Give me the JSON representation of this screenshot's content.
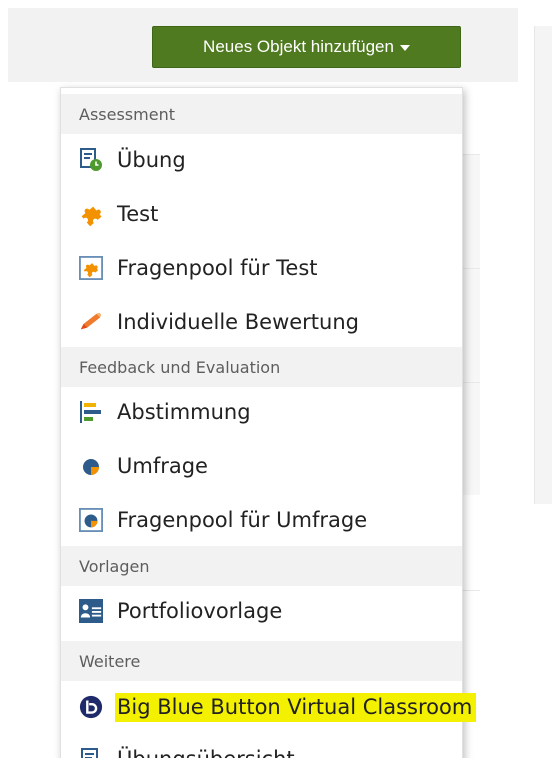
{
  "toolbar": {
    "add_button_label": "Neues Objekt hinzufügen"
  },
  "menu": {
    "sections": [
      {
        "header": "Assessment",
        "items": [
          {
            "label": "Übung",
            "icon": "exercise-icon"
          },
          {
            "label": "Test",
            "icon": "puzzle-icon"
          },
          {
            "label": "Fragenpool für Test",
            "icon": "test-question-pool-icon"
          },
          {
            "label": "Individuelle Bewertung",
            "icon": "pencil-icon"
          }
        ]
      },
      {
        "header": "Feedback und Evaluation",
        "items": [
          {
            "label": "Abstimmung",
            "icon": "poll-icon"
          },
          {
            "label": "Umfrage",
            "icon": "survey-icon"
          },
          {
            "label": "Fragenpool für Umfrage",
            "icon": "survey-question-pool-icon"
          }
        ]
      },
      {
        "header": "Vorlagen",
        "items": [
          {
            "label": "Portfoliovorlage",
            "icon": "portfolio-template-icon"
          }
        ]
      },
      {
        "header": "Weitere",
        "items": [
          {
            "label": "Big Blue Button Virtual Classroom",
            "icon": "bigbluebutton-icon",
            "highlighted": true
          },
          {
            "label": "Übungsübersicht",
            "icon": "exercise-overview-icon"
          }
        ]
      }
    ]
  },
  "colors": {
    "button_green": "#4f7a1f",
    "highlight_yellow": "#f4f100",
    "orange": "#f39200",
    "blue_accent": "#2e5c8a"
  }
}
